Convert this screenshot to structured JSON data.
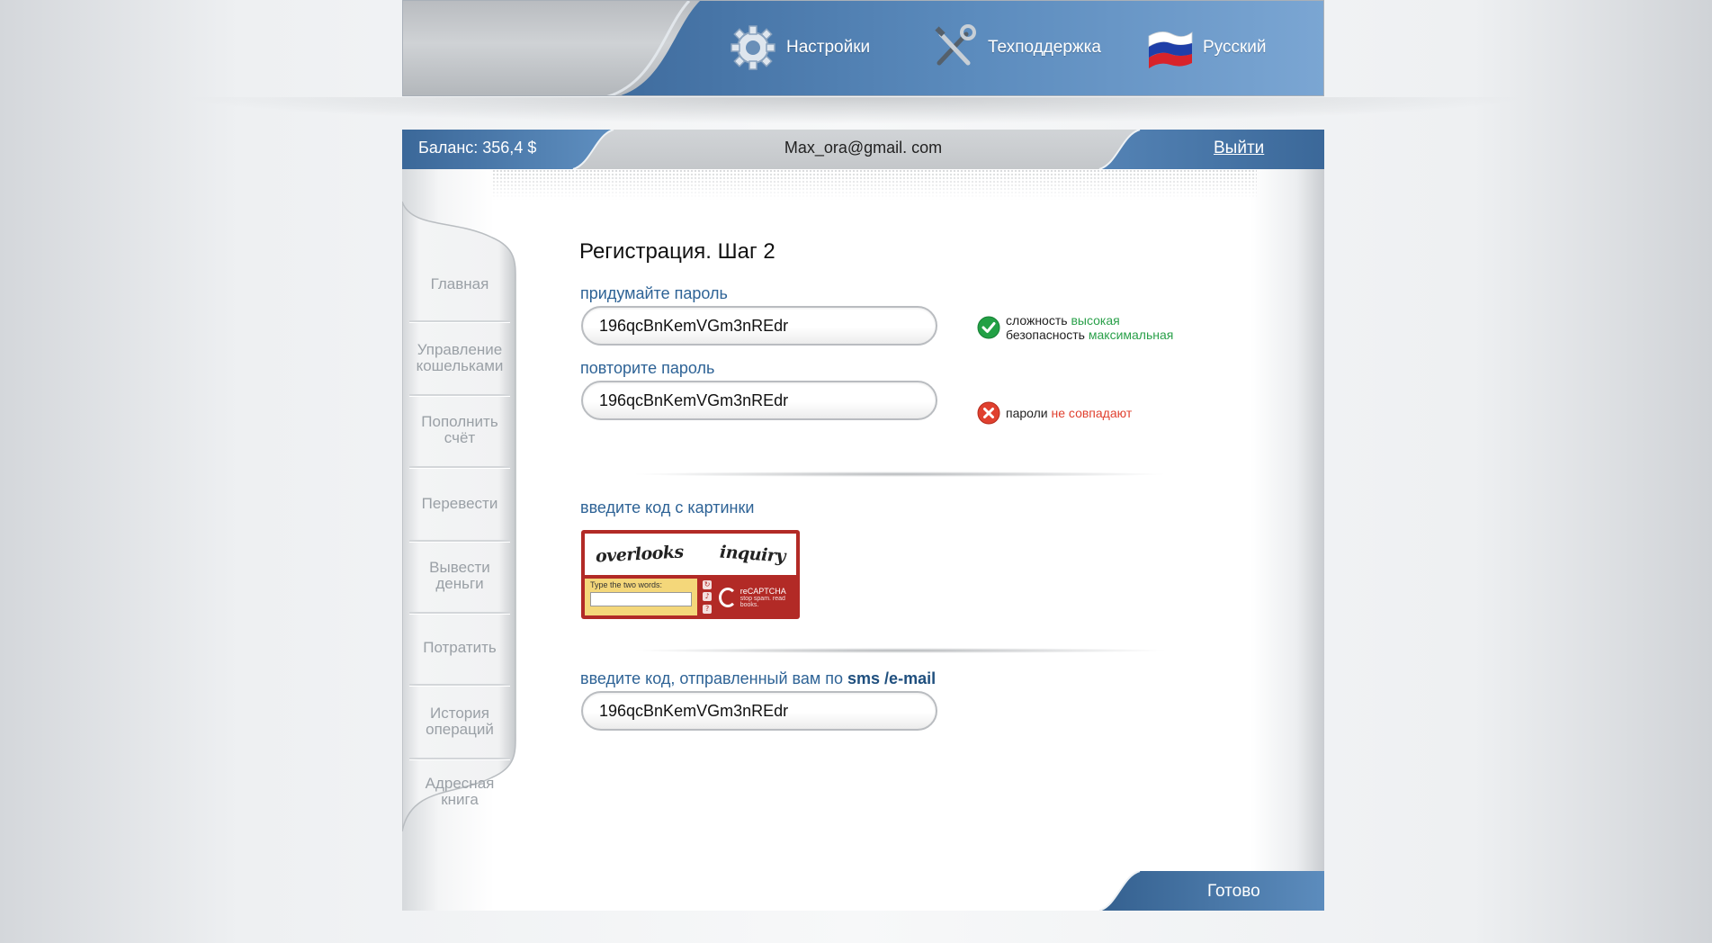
{
  "top_nav": {
    "settings_label": "Настройки",
    "support_label": "Техподдержка",
    "language_label": "Русский"
  },
  "status": {
    "balance": "Баланс: 356,4 $",
    "email": "Max_ora@gmail. com",
    "logout_label": "Выйти"
  },
  "sidebar": {
    "items": [
      {
        "label": "Главная"
      },
      {
        "label": "Управление кошельками"
      },
      {
        "label": "Пополнить счёт"
      },
      {
        "label": "Перевести"
      },
      {
        "label": "Вывести деньги"
      },
      {
        "label": "Потратить"
      },
      {
        "label": "История операций"
      },
      {
        "label": "Адресная книга"
      }
    ]
  },
  "form": {
    "title": "Регистрация. Шаг 2",
    "password_label": "придумайте пароль",
    "password_value": "196qcBnKemVGm3nREdr",
    "repeat_label": "повторите пароль",
    "repeat_value": "196qcBnKemVGm3nREdr",
    "strength": {
      "line1_prefix": "сложность ",
      "line1_value": "высокая",
      "line2_prefix": "безопасность ",
      "line2_value": "максимальная"
    },
    "mismatch": {
      "prefix": "пароли ",
      "value": "не совпадают"
    },
    "captcha_label": "введите код с картинки",
    "captcha": {
      "word1": "overlooks",
      "word2": "inquiry",
      "prompt": "Type the two words:",
      "brand": "reCAPTCHA",
      "tagline": "stop spam. read books."
    },
    "sms_label_prefix": "введите код, отправленный вам по ",
    "sms_label_bold": "sms /e-mail",
    "sms_value": "196qcBnKemVGm3nREdr"
  },
  "footer": {
    "done_label": "Готово"
  },
  "colors": {
    "brand_blue": "#4f7fb0",
    "label_blue": "#2e6396",
    "ok_green": "#2aa04a",
    "error_red": "#e0402f"
  }
}
